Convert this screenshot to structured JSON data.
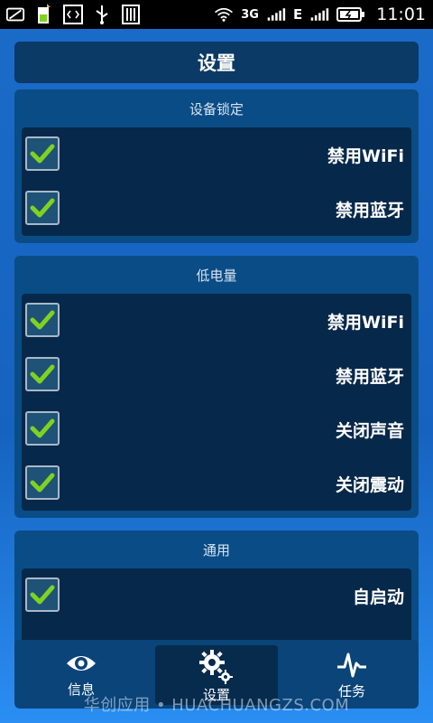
{
  "status_bar": {
    "time": "11:01",
    "network_type": "3G",
    "edge_label": "E",
    "icons_left": [
      "messages-icon",
      "sim-icon",
      "code-icon",
      "usb-icon",
      "barcode-icon"
    ],
    "icons_right": [
      "wifi-icon",
      "signal-icon",
      "signal2-icon",
      "battery-icon"
    ]
  },
  "header": {
    "title": "设置"
  },
  "sections": [
    {
      "title": "设备锁定",
      "items": [
        {
          "label": "禁用WiFi",
          "checked": true
        },
        {
          "label": "禁用蓝牙",
          "checked": true
        }
      ]
    },
    {
      "title": "低电量",
      "items": [
        {
          "label": "禁用WiFi",
          "checked": true
        },
        {
          "label": "禁用蓝牙",
          "checked": true
        },
        {
          "label": "关闭声音",
          "checked": true
        },
        {
          "label": "关闭震动",
          "checked": true
        }
      ]
    },
    {
      "title": "通用",
      "items": [
        {
          "label": "自启动",
          "checked": true
        }
      ]
    }
  ],
  "bottom_nav": {
    "items": [
      {
        "label": "信息",
        "icon": "eye-icon"
      },
      {
        "label": "设置",
        "icon": "gears-icon",
        "active": true
      },
      {
        "label": "任务",
        "icon": "pulse-icon"
      }
    ]
  },
  "watermark": "华创应用 • HUACHUANGZS.COM",
  "colors": {
    "check": "#7ed321",
    "panel": "#0a4c86",
    "panel_inner": "#06284a",
    "header": "#0b3a66"
  }
}
